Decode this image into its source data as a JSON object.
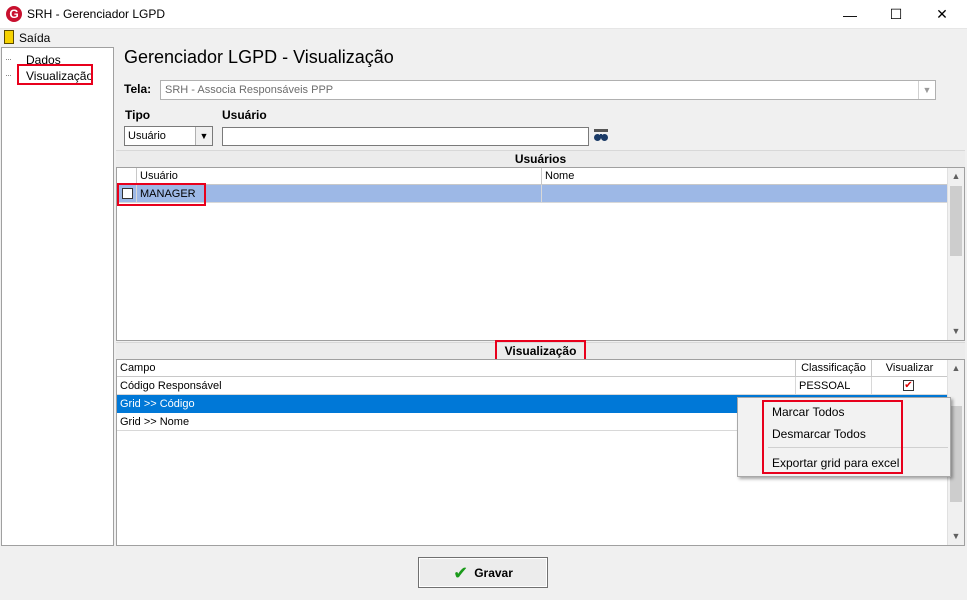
{
  "window": {
    "title": "SRH - Gerenciador LGPD",
    "app_icon_letter": "G",
    "minimize": "—",
    "maximize": "☐",
    "close": "✕"
  },
  "menu": {
    "exit_label": "Saída"
  },
  "tree": {
    "items": [
      {
        "label": "Dados"
      },
      {
        "label": "Visualização"
      }
    ]
  },
  "header": {
    "title": "Gerenciador LGPD - Visualização",
    "tela_label": "Tela:",
    "tela_value": "SRH - Associa Responsáveis PPP",
    "tipo_label": "Tipo",
    "usuario_label": "Usuário",
    "tipo_value": "Usuário",
    "usuario_value": ""
  },
  "users_section": {
    "title": "Usuários",
    "columns": [
      "Usuário",
      "Nome"
    ],
    "rows": [
      {
        "usuario": "MANAGER",
        "nome": "",
        "checked": false
      }
    ]
  },
  "visual_section": {
    "title": "Visualização",
    "columns": [
      "Campo",
      "Classificação",
      "Visualizar"
    ],
    "rows": [
      {
        "campo": "Código Responsável",
        "classificacao": "PESSOAL",
        "visualizar": true
      },
      {
        "campo": "Grid >> Código",
        "classificacao": "",
        "visualizar": false
      },
      {
        "campo": "Grid >> Nome",
        "classificacao": "",
        "visualizar": false
      }
    ]
  },
  "context_menu": {
    "items": [
      "Marcar Todos",
      "Desmarcar Todos",
      "Exportar grid para excel"
    ]
  },
  "footer": {
    "save_label": "Gravar"
  },
  "colors": {
    "highlight": "#e8001c",
    "selection": "#0078d7",
    "row_selected": "#9db8e6"
  }
}
